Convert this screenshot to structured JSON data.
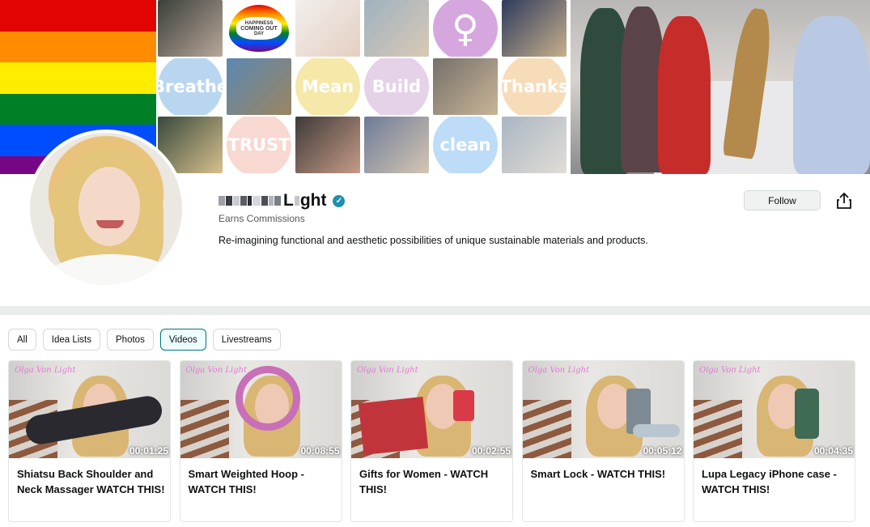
{
  "banner": {
    "flag_colors": [
      "#e40303",
      "#ff8c00",
      "#ffed00",
      "#008026",
      "#004dff",
      "#750787"
    ],
    "tiles": [
      {
        "kind": "photo",
        "colors": [
          "#3a3f3a",
          "#b9a79a"
        ]
      },
      {
        "kind": "heart",
        "text_top": "HAPPINESS",
        "text_main": "COMING OUT",
        "text_bottom": "DAY"
      },
      {
        "kind": "photo",
        "colors": [
          "#f2efee",
          "#e4cfc0"
        ]
      },
      {
        "kind": "photo",
        "colors": [
          "#9fb2c0",
          "#d9c9b5"
        ]
      },
      {
        "kind": "circle",
        "text": "",
        "symbol": "♀",
        "bg": "#d6a6de"
      },
      {
        "kind": "photo",
        "colors": [
          "#2e3a5e",
          "#c7b08a"
        ]
      },
      {
        "kind": "circle",
        "text": "Breathe",
        "symbol": "",
        "bg": "#b9d6f1"
      },
      {
        "kind": "photo",
        "colors": [
          "#5a88b2",
          "#9b8561"
        ]
      },
      {
        "kind": "circle",
        "text": "Mean",
        "symbol": "",
        "bg": "#f5e8a8"
      },
      {
        "kind": "circle",
        "text": "Build",
        "symbol": "",
        "bg": "#e5d1e8"
      },
      {
        "kind": "photo",
        "colors": [
          "#74706b",
          "#c9b596"
        ]
      },
      {
        "kind": "circle",
        "text": "Thanks",
        "symbol": "",
        "bg": "#f6dcb9"
      },
      {
        "kind": "photo",
        "colors": [
          "#37493b",
          "#d8c08e"
        ]
      },
      {
        "kind": "circle",
        "text": "TRUST",
        "symbol": "",
        "bg": "#f7d9d1"
      },
      {
        "kind": "photo",
        "colors": [
          "#3e3a39",
          "#c69b86"
        ]
      },
      {
        "kind": "photo",
        "colors": [
          "#6c7b98",
          "#d6c6b3"
        ]
      },
      {
        "kind": "circle",
        "text": "clean",
        "symbol": "",
        "bg": "#bcdcf7"
      },
      {
        "kind": "photo",
        "colors": [
          "#a9b6c3",
          "#e2ddd6"
        ]
      }
    ]
  },
  "profile": {
    "name_visible": "ght",
    "name_first_letter": "L",
    "subtitle": "Earns Commissions",
    "bio": "Re-imagining functional and aesthetic possibilities of unique sustainable materials and products.",
    "follow_label": "Follow",
    "accent": "#007185"
  },
  "tabs": [
    {
      "label": "All",
      "active": false
    },
    {
      "label": "Idea Lists",
      "active": false
    },
    {
      "label": "Photos",
      "active": false
    },
    {
      "label": "Videos",
      "active": true
    },
    {
      "label": "Livestreams",
      "active": false
    }
  ],
  "videos": [
    {
      "title": "Shiatsu Back Shoulder and Neck Massager WATCH THIS!",
      "duration": "00:01:25",
      "watermark": "Olga Von Light",
      "prop": "massager"
    },
    {
      "title": "Smart Weighted Hoop - WATCH THIS!",
      "duration": "00:08:55",
      "watermark": "Olga Von Light",
      "prop": "hoop"
    },
    {
      "title": "Gifts for Women - WATCH THIS!",
      "duration": "00:02:55",
      "watermark": "Olga Von Light",
      "prop": "gift"
    },
    {
      "title": "Smart Lock - WATCH THIS!",
      "duration": "00:05:12",
      "watermark": "Olga Von Light",
      "prop": "lock"
    },
    {
      "title": "Lupa Legacy iPhone case - WATCH THIS!",
      "duration": "00:04:35",
      "watermark": "Olga Von Light",
      "prop": "phone"
    }
  ]
}
